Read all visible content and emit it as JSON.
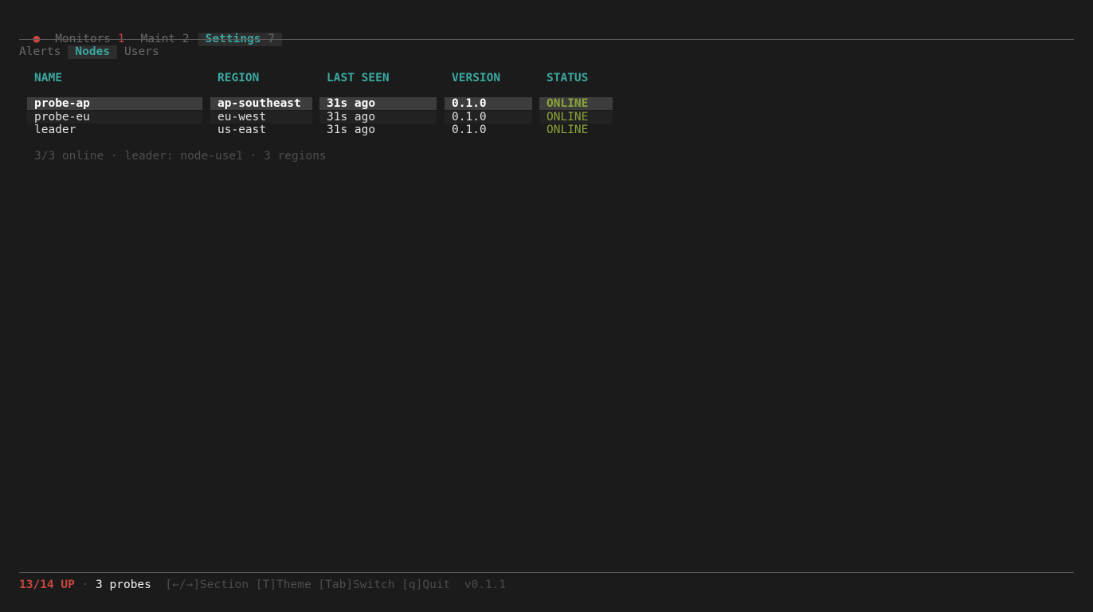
{
  "tabbar": {
    "status_dot": "●",
    "tabs": [
      {
        "label": "Monitors",
        "count": "1",
        "active": false
      },
      {
        "label": "Maint",
        "count": "2",
        "active": false
      },
      {
        "label": "Settings",
        "count": "7",
        "active": true
      }
    ]
  },
  "subtabs": [
    {
      "label": "Alerts",
      "active": false
    },
    {
      "label": "Nodes",
      "active": true
    },
    {
      "label": "Users",
      "active": false
    }
  ],
  "table": {
    "headers": [
      "NAME",
      "REGION",
      "LAST SEEN",
      "VERSION",
      "STATUS"
    ],
    "rows": [
      {
        "name": "probe-ap",
        "region": "ap-southeast",
        "last_seen": "31s ago",
        "version": "0.1.0",
        "status": "ONLINE",
        "selected": true
      },
      {
        "name": "probe-eu",
        "region": "eu-west",
        "last_seen": "31s ago",
        "version": "0.1.0",
        "status": "ONLINE",
        "selected": false
      },
      {
        "name": "leader",
        "region": "us-east",
        "last_seen": "31s ago",
        "version": "0.1.0",
        "status": "ONLINE",
        "selected": false
      }
    ]
  },
  "summary": "3/3 online · leader: node-use1 · 3 regions",
  "footer": {
    "up": "13/14 UP",
    "sep": "·",
    "probes": "3 probes",
    "keys": "[←/→]Section [T]Theme [Tab]Switch [q]Quit",
    "version": "v0.1.1"
  },
  "colors": {
    "background": "#1b1b1b",
    "accent": "#3aa8a0",
    "alert": "#c9463d",
    "online": "#8ba33a"
  }
}
